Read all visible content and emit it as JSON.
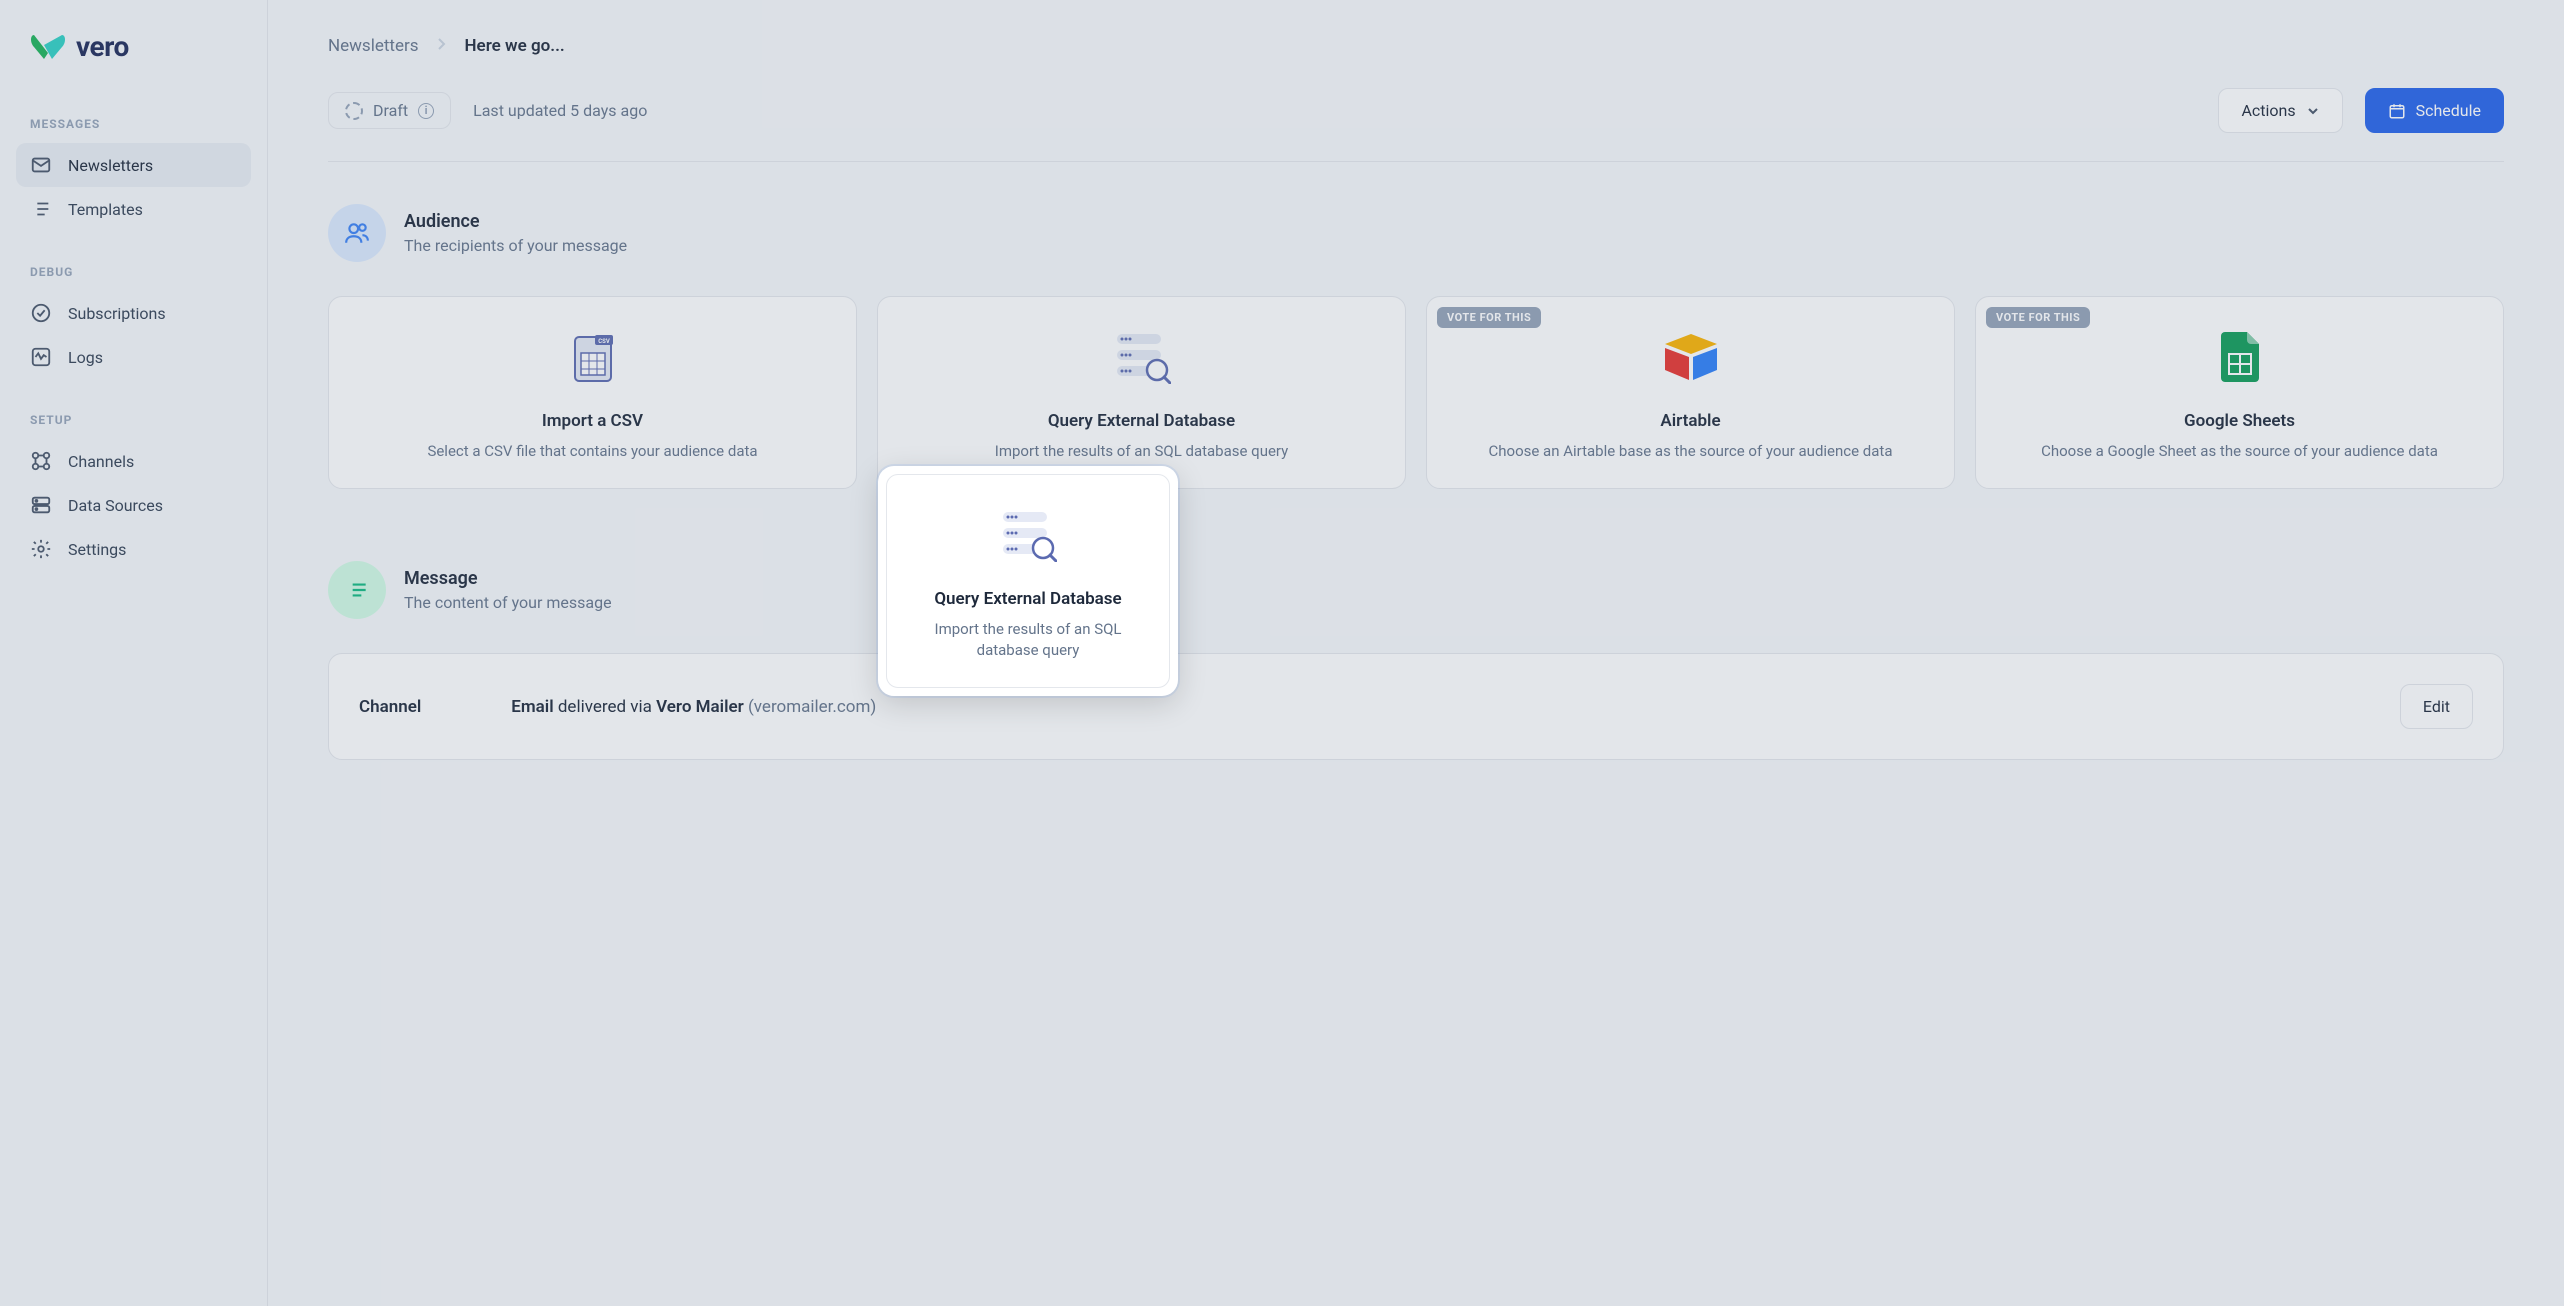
{
  "brand": "vero",
  "sidebar": {
    "sections": [
      {
        "heading": "MESSAGES",
        "items": [
          {
            "label": "Newsletters"
          },
          {
            "label": "Templates"
          }
        ]
      },
      {
        "heading": "DEBUG",
        "items": [
          {
            "label": "Subscriptions"
          },
          {
            "label": "Logs"
          }
        ]
      },
      {
        "heading": "SETUP",
        "items": [
          {
            "label": "Channels"
          },
          {
            "label": "Data Sources"
          },
          {
            "label": "Settings"
          }
        ]
      }
    ]
  },
  "breadcrumb": {
    "parent": "Newsletters",
    "current": "Here we go..."
  },
  "status": {
    "badge": "Draft",
    "updated": "Last updated 5 days ago"
  },
  "toolbar": {
    "actions": "Actions",
    "schedule": "Schedule"
  },
  "audience": {
    "title": "Audience",
    "subtitle": "The recipients of your message",
    "cards": [
      {
        "title": "Import a CSV",
        "desc": "Select a CSV file that contains your audience data"
      },
      {
        "title": "Query External Database",
        "desc": "Import the results of an SQL database query"
      },
      {
        "title": "Airtable",
        "desc": "Choose an Airtable base as the source of your audience data",
        "vote": "VOTE FOR THIS"
      },
      {
        "title": "Google Sheets",
        "desc": "Choose a Google Sheet as the source of your audience data",
        "vote": "VOTE FOR THIS"
      }
    ]
  },
  "message": {
    "title": "Message",
    "subtitle": "The content of your message",
    "channel_label": "Channel",
    "email": "Email",
    "delivered": " delivered via ",
    "mailer": "Vero Mailer",
    "domain": "(veromailer.com)",
    "edit": "Edit"
  }
}
